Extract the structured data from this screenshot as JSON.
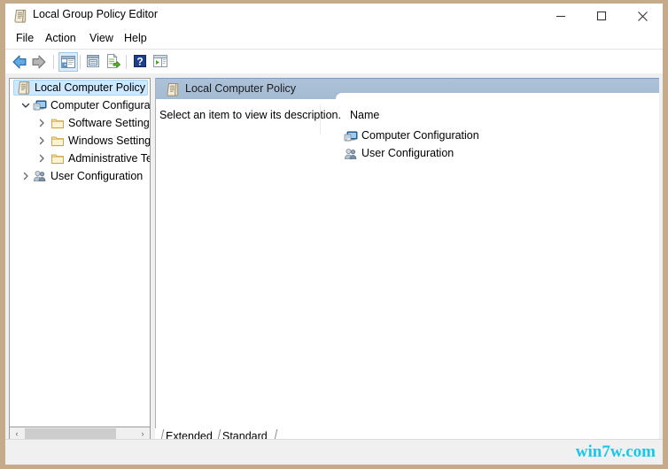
{
  "window": {
    "title": "Local Group Policy Editor",
    "title_icon": "policy-document-icon",
    "border_color": "#c6ab8a",
    "controls": {
      "minimize_label": "Minimize",
      "maximize_label": "Maximize",
      "close_label": "Close"
    }
  },
  "menubar": {
    "items": [
      {
        "label": "File"
      },
      {
        "label": "Action"
      },
      {
        "label": "View"
      },
      {
        "label": "Help"
      }
    ]
  },
  "toolbar": {
    "buttons": [
      {
        "name": "back-button",
        "icon": "arrow-left-icon",
        "tooltip": "Back",
        "enabled": true,
        "active": false
      },
      {
        "name": "forward-button",
        "icon": "arrow-right-icon",
        "tooltip": "Forward",
        "enabled": false,
        "active": false
      },
      {
        "name": "show-hide-console-tree-button",
        "icon": "console-tree-icon",
        "tooltip": "Show/Hide Console Tree",
        "enabled": true,
        "active": true
      },
      {
        "name": "properties-button",
        "icon": "properties-icon",
        "tooltip": "Properties",
        "enabled": true,
        "active": false
      },
      {
        "name": "export-list-button",
        "icon": "export-list-icon",
        "tooltip": "Export List",
        "enabled": true,
        "active": false
      },
      {
        "name": "help-button",
        "icon": "question-mark-icon",
        "tooltip": "Help",
        "enabled": true,
        "active": false
      },
      {
        "name": "show-hide-action-pane-button",
        "icon": "action-pane-icon",
        "tooltip": "Show/Hide Action Pane",
        "enabled": true,
        "active": false
      }
    ]
  },
  "tree": {
    "items": [
      {
        "label": "Local Computer Policy",
        "icon": "policy-document-icon",
        "indent": 0,
        "twisty": "none",
        "selected": true
      },
      {
        "label": "Computer Configura",
        "icon": "computer-icon",
        "indent": 1,
        "twisty": "expanded",
        "selected": false
      },
      {
        "label": "Software Settings",
        "icon": "folder-icon",
        "indent": 2,
        "twisty": "collapsed",
        "selected": false
      },
      {
        "label": "Windows Setting",
        "icon": "folder-icon",
        "indent": 2,
        "twisty": "collapsed",
        "selected": false
      },
      {
        "label": "Administrative Te",
        "icon": "folder-icon",
        "indent": 2,
        "twisty": "collapsed",
        "selected": false
      },
      {
        "label": "User Configuration",
        "icon": "user-icon",
        "indent": 1,
        "twisty": "collapsed",
        "selected": false
      }
    ],
    "hscroll": {
      "left_arrow": "‹",
      "right_arrow": "›"
    }
  },
  "right_pane": {
    "header": {
      "title": "Local Computer Policy",
      "icon": "policy-document-icon",
      "background_color": "#a8bed4"
    },
    "description": "Select an item to view its description.",
    "list": {
      "columns": [
        "Name"
      ],
      "rows": [
        {
          "name": "Computer Configuration",
          "icon": "computer-icon"
        },
        {
          "name": "User Configuration",
          "icon": "user-icon"
        }
      ]
    }
  },
  "tabs": {
    "items": [
      {
        "label": "Extended",
        "selected": false
      },
      {
        "label": "Standard",
        "selected": true
      }
    ]
  },
  "watermark": {
    "text": "win7w.com",
    "color": "#18c8e8"
  }
}
